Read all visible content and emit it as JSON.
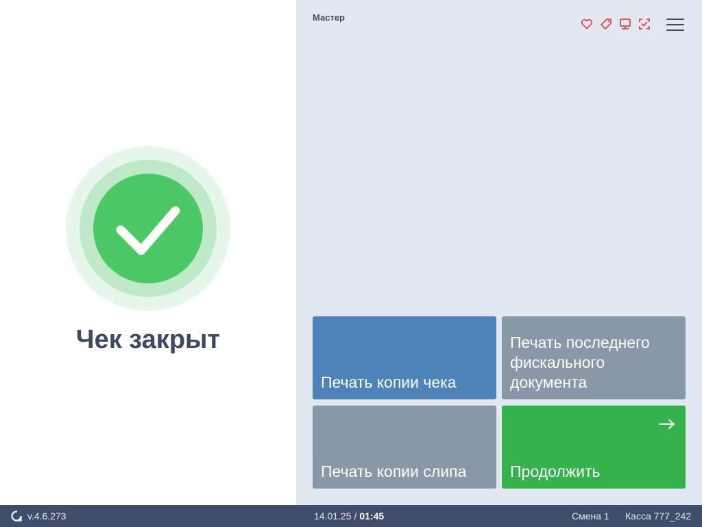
{
  "status": {
    "title": "Чек закрыт",
    "icon": "check-icon",
    "accent_color": "#4cc864"
  },
  "header": {
    "user_name": "Мастер",
    "icons": [
      "heart-icon",
      "tag-icon",
      "monitor-icon",
      "scan-check-icon"
    ],
    "icon_color": "#e8414f",
    "menu_icon": "hamburger-menu-icon"
  },
  "actions": {
    "print_receipt_copy": "Печать копии чека",
    "print_last_fiscal": "Печать последнего фискального документа",
    "print_slip_copy": "Печать копии слипа",
    "continue": "Продолжить"
  },
  "colors": {
    "blue_tile": "#4d83b8",
    "gray_tile": "#8898a8",
    "green_tile": "#36b24d",
    "status_bar": "#3f4d68"
  },
  "statusbar": {
    "version": "v.4.6.273",
    "date": "14.01.25",
    "separator": "/",
    "time": "01:45",
    "shift": "Смена 1",
    "kassa": "Касса 777_242"
  }
}
